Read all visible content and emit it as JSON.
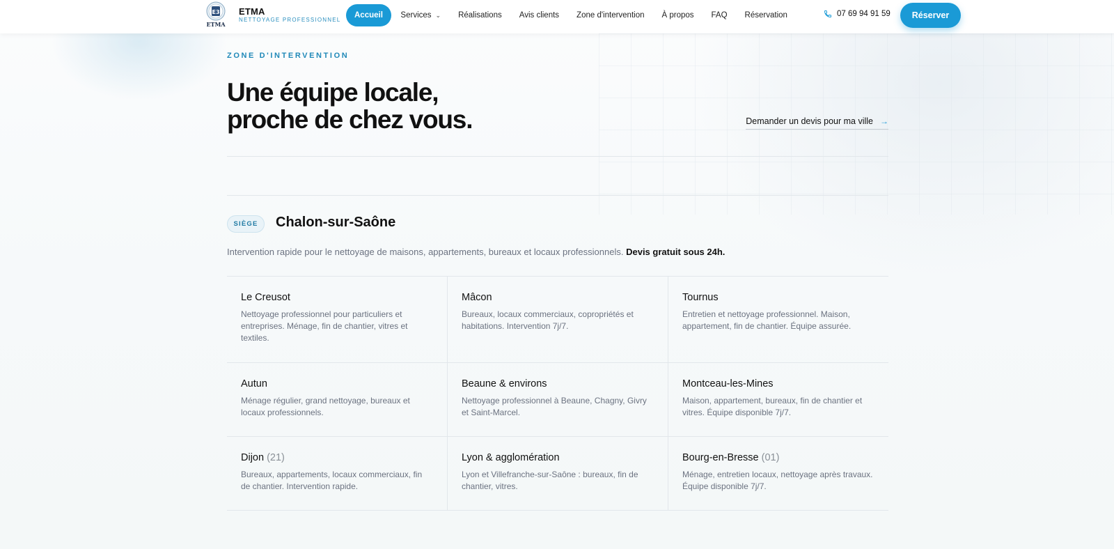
{
  "brand": {
    "name": "ETMA",
    "tagline": "NETTOYAGE PROFESSIONNEL",
    "mark_text": "ETMA",
    "mark_letters": "E3"
  },
  "nav": {
    "items": [
      {
        "label": "Accueil",
        "active": true
      },
      {
        "label": "Services",
        "has_dropdown": true
      },
      {
        "label": "Réalisations"
      },
      {
        "label": "Avis clients"
      },
      {
        "label": "Zone d'intervention"
      },
      {
        "label": "À propos"
      },
      {
        "label": "FAQ"
      },
      {
        "label": "Réservation"
      }
    ],
    "phone": "07 69 94 91 59",
    "cta_label": "Réserver"
  },
  "zone": {
    "eyebrow": "ZONE D'INTERVENTION",
    "headline_line1": "Une équipe locale,",
    "headline_line2": "proche de chez vous.",
    "quote_link": "Demander un devis pour ma ville",
    "hq": {
      "badge": "SIÈGE",
      "city": "Chalon-sur-Saône",
      "desc": "Intervention rapide pour le nettoyage de maisons, appartements, bureaux et locaux professionnels.",
      "desc_bold": "Devis gratuit sous 24h."
    },
    "cities": [
      {
        "name": "Le Creusot",
        "code": "",
        "desc": "Nettoyage professionnel pour particuliers et entreprises. Ménage, fin de chantier, vitres et textiles."
      },
      {
        "name": "Mâcon",
        "code": "",
        "desc": "Bureaux, locaux commerciaux, copropriétés et habitations. Intervention 7j/7."
      },
      {
        "name": "Tournus",
        "code": "",
        "desc": "Entretien et nettoyage professionnel. Maison, appartement, fin de chantier. Équipe assurée."
      },
      {
        "name": "Autun",
        "code": "",
        "desc": "Ménage régulier, grand nettoyage, bureaux et locaux professionnels."
      },
      {
        "name": "Beaune & environs",
        "code": "",
        "desc": "Nettoyage professionnel à Beaune, Chagny, Givry et Saint-Marcel."
      },
      {
        "name": "Montceau-les-Mines",
        "code": "",
        "desc": "Maison, appartement, bureaux, fin de chantier et vitres. Équipe disponible 7j/7."
      },
      {
        "name": "Dijon",
        "code": "(21)",
        "desc": "Bureaux, appartements, locaux commerciaux, fin de chantier. Intervention rapide."
      },
      {
        "name": "Lyon & agglomération",
        "code": "",
        "desc": "Lyon et Villefranche-sur-Saône : bureaux, fin de chantier, vitres."
      },
      {
        "name": "Bourg-en-Bresse",
        "code": "(01)",
        "desc": "Ménage, entretien locaux, nettoyage après travaux. Équipe disponible 7j/7."
      }
    ]
  },
  "icons": {
    "phone": "phone-icon",
    "arrow": "arrow-right-icon",
    "chevron": "chevron-down-icon"
  },
  "colors": {
    "accent": "#1a9ad6",
    "eyebrow": "#2089b8",
    "text": "#111827",
    "muted": "#6b7280"
  }
}
